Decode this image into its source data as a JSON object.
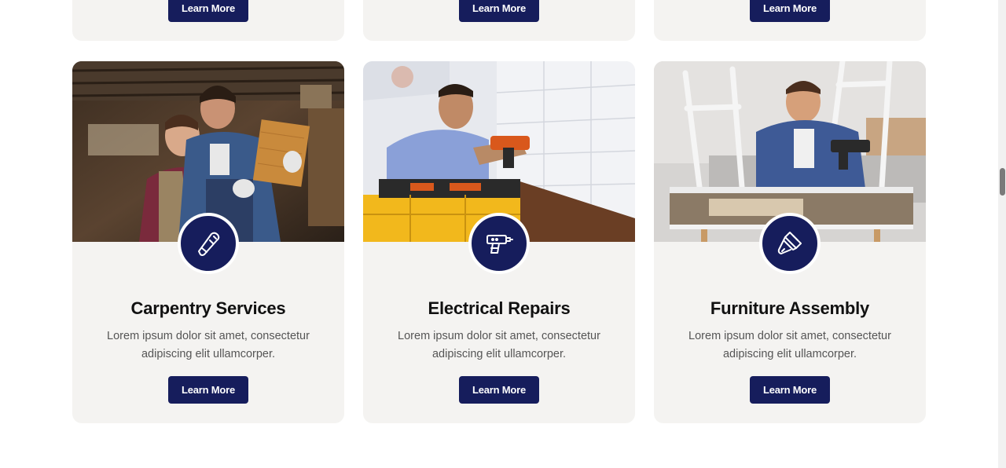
{
  "top_row": {
    "buttons": [
      {
        "label": "Learn More"
      },
      {
        "label": "Learn More"
      },
      {
        "label": "Learn More"
      }
    ]
  },
  "services": [
    {
      "title": "Carpentry Services",
      "description": "Lorem ipsum dolor sit amet, consectetur adipiscing elit ullamcorper.",
      "button_label": "Learn More",
      "icon": "hand-plane-icon"
    },
    {
      "title": "Electrical Repairs",
      "description": "Lorem ipsum dolor sit amet, consectetur adipiscing elit ullamcorper.",
      "button_label": "Learn More",
      "icon": "power-drill-icon"
    },
    {
      "title": "Furniture Assembly",
      "description": "Lorem ipsum dolor sit amet, consectetur adipiscing elit ullamcorper.",
      "button_label": "Learn More",
      "icon": "paint-brush-icon"
    }
  ],
  "colors": {
    "accent": "#161d5c",
    "card_background": "#f4f3f1",
    "title": "#111111",
    "body_text": "#555555"
  }
}
